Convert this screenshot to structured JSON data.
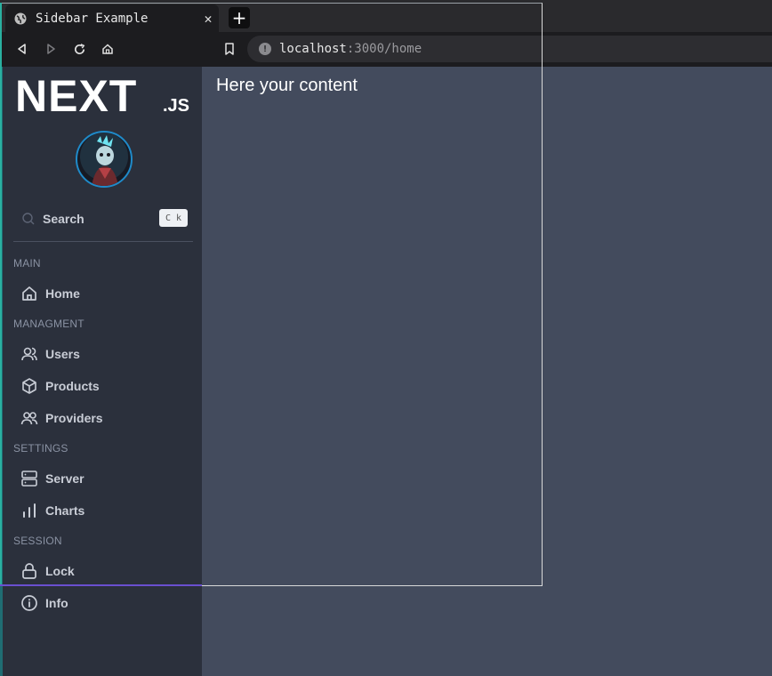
{
  "browser": {
    "tab_title": "Sidebar Example",
    "tab_close": "✕",
    "new_tab": "+",
    "url_host": "localhost",
    "url_path": ":3000/home"
  },
  "sidebar": {
    "logo_main": "NEXT",
    "logo_suffix": ".JS",
    "search_label": "Search",
    "search_shortcut": "C k",
    "sections": {
      "main": "MAIN",
      "managment": "MANAGMENT",
      "settings": "SETTINGS",
      "session": "SESSION"
    },
    "items": {
      "home": "Home",
      "users": "Users",
      "products": "Products",
      "providers": "Providers",
      "server": "Server",
      "charts": "Charts",
      "lock": "Lock",
      "info": "Info"
    }
  },
  "main": {
    "content_text": "Here your content"
  },
  "colors": {
    "sidebar_bg": "#2b303c",
    "main_bg": "#434b5d",
    "accent_avatar_ring": "#1f8ac9"
  }
}
